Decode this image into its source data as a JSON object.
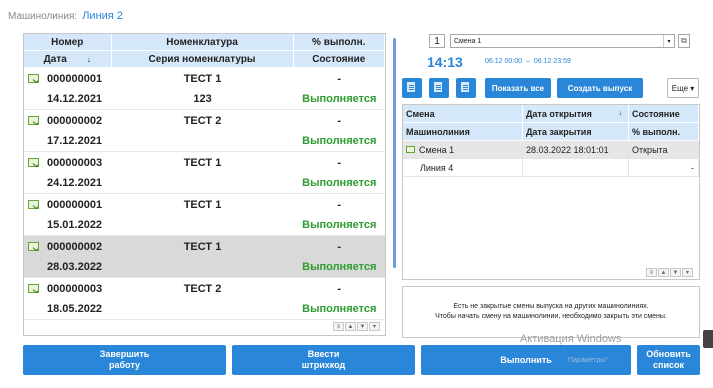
{
  "header": {
    "label": "Машинолиния:",
    "value": "Линия 2"
  },
  "left_table": {
    "headers_row1": [
      "Номер",
      "Номенклатура",
      "% выполн."
    ],
    "headers_row2": [
      "Дата",
      "Серия номенклатуры",
      "Состояние"
    ],
    "sort_indicator": "↓",
    "rows": [
      {
        "number": "000000001",
        "nomenclature": "ТЕСТ 1",
        "percent": "-",
        "date": "14.12.2021",
        "series": "123",
        "status": "Выполняется"
      },
      {
        "number": "000000002",
        "nomenclature": "ТЕСТ 2",
        "percent": "-",
        "date": "17.12.2021",
        "series": "",
        "status": "Выполняется"
      },
      {
        "number": "000000003",
        "nomenclature": "ТЕСТ 1",
        "percent": "-",
        "date": "24.12.2021",
        "series": "",
        "status": "Выполняется"
      },
      {
        "number": "000000001",
        "nomenclature": "ТЕСТ 1",
        "percent": "-",
        "date": "15.01.2022",
        "series": "",
        "status": "Выполняется"
      },
      {
        "number": "000000002",
        "nomenclature": "ТЕСТ 1",
        "percent": "-",
        "date": "28.03.2022",
        "series": "",
        "status": "Выполняется",
        "selected": true
      },
      {
        "number": "000000003",
        "nomenclature": "ТЕСТ 2",
        "percent": "-",
        "date": "18.05.2022",
        "series": "",
        "status": "Выполняется"
      }
    ]
  },
  "right_panel": {
    "shift_number": "1",
    "shift_select": "Смена 1",
    "dropdown_glyph": "▾",
    "open_glyph": "⧉",
    "time": "14:13",
    "range_start": "06.12 00:00",
    "range_sep": "–",
    "range_end": "06.12 23:59",
    "show_all_label": "Показать все",
    "create_label": "Создать выпуск",
    "more_label": "Еще ▾",
    "table": {
      "headers_row1": [
        "Смена",
        "Дата открытия",
        "Состояние"
      ],
      "headers_row2": [
        "Машинолиния",
        "Дата закрытия",
        "% выполн."
      ],
      "sort_indicator": "↓",
      "rows": [
        {
          "shift": "Смена 1",
          "opened": "28.03.2022 18:01:01",
          "state": "Открыта"
        },
        {
          "line": "Линия 4",
          "closed": "",
          "percent": "-"
        }
      ]
    },
    "info_line1": "Есть не закрытые смены выпуска на других машинолиниях.",
    "info_line2": "Чтобы начать смену на машинолинии, необходимо закрыть эти смены."
  },
  "scroll_glyphs": [
    "≡",
    "▲",
    "▼",
    "▾"
  ],
  "buttons": {
    "finish_line1": "Завершить",
    "finish_line2": "работу",
    "barcode_line1": "Ввести",
    "barcode_line2": "штрихкод",
    "execute": "Выполнить",
    "refresh_line1": "Обновить",
    "refresh_line2": "список"
  },
  "watermark": {
    "title": "Активация Windows",
    "subtitle": "Параметры\""
  },
  "colors": {
    "accent": "#2a86d9",
    "header_bg": "#d4e8fa",
    "status_green": "#2e9c2e",
    "selected_row": "#d9d9d9"
  }
}
